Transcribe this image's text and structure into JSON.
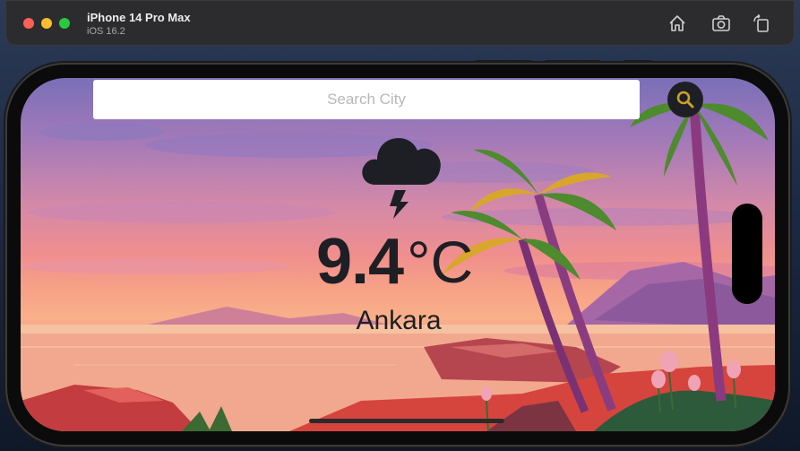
{
  "window": {
    "device_name": "iPhone 14 Pro Max",
    "os_version": "iOS 16.2",
    "toolbar": [
      {
        "name": "home-icon"
      },
      {
        "name": "screenshot-icon"
      },
      {
        "name": "rotate-icon"
      }
    ]
  },
  "app": {
    "search": {
      "placeholder": "Search City",
      "value": ""
    },
    "search_button_icon": "magnifier-icon",
    "weather_icon": "thunderstorm-icon",
    "temperature": "9.4",
    "unit": "°C",
    "city": "Ankara"
  },
  "colors": {
    "text_dark": "#1d1f24",
    "search_button": "#1e1f24"
  }
}
